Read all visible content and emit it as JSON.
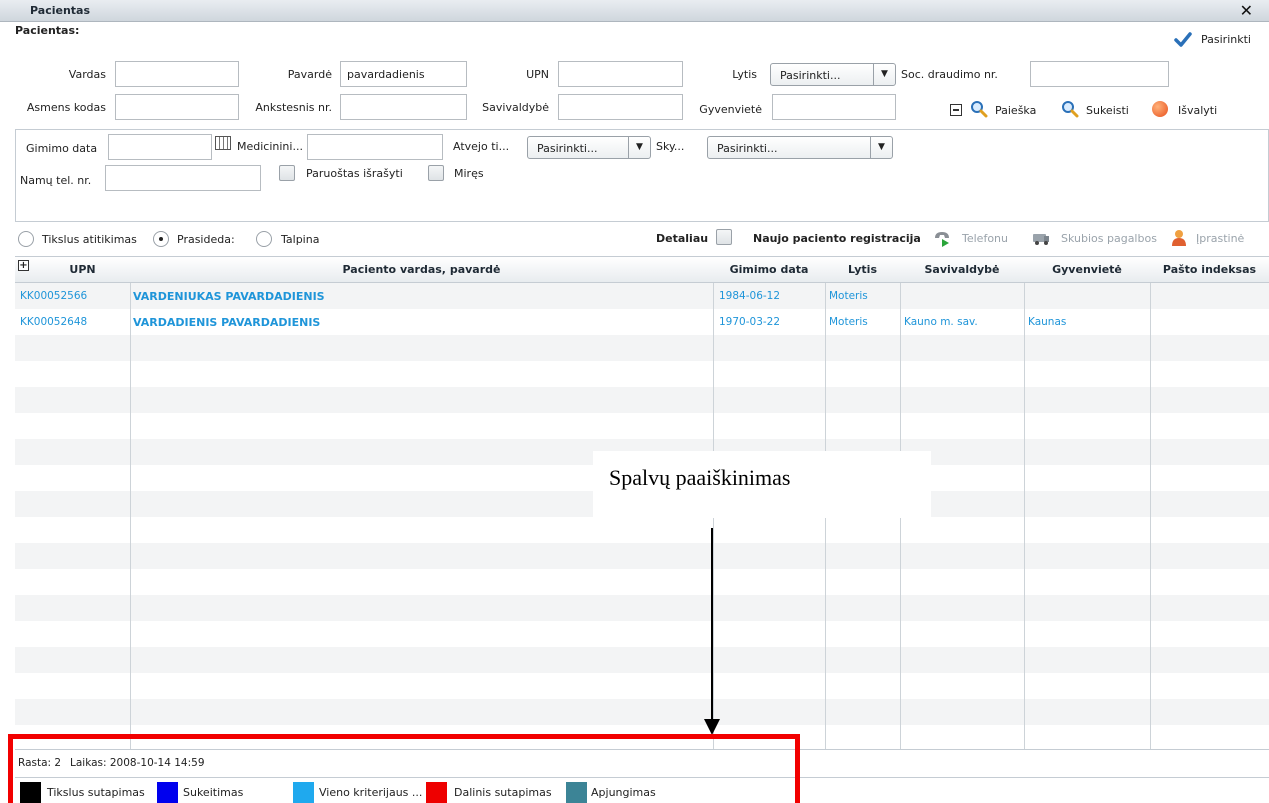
{
  "window": {
    "title": "Pacientas",
    "close_symbol": "✕"
  },
  "section_title": "Pacientas:",
  "select_button": "Pasirinkti",
  "fields": {
    "vardas": {
      "label": "Vardas",
      "value": ""
    },
    "pavarde": {
      "label": "Pavardė",
      "value": "pavardadienis"
    },
    "upn": {
      "label": "UPN",
      "value": ""
    },
    "lytis": {
      "label": "Lytis",
      "value": "Pasirinkti..."
    },
    "soc": {
      "label": "Soc. draudimo nr.",
      "value": ""
    },
    "asmens_kodas": {
      "label": "Asmens kodas",
      "value": ""
    },
    "ankstesnis": {
      "label": "Ankstesnis nr.",
      "value": ""
    },
    "savivaldybe": {
      "label": "Savivaldybė",
      "value": ""
    },
    "gyvenviete": {
      "label": "Gyvenvietė",
      "value": ""
    }
  },
  "actions": {
    "search": "Paieška",
    "swap": "Sukeisti",
    "clear": "Išvalyti"
  },
  "extra": {
    "gimimo_data": "Gimimo data",
    "medicinini": "Medicinini...",
    "atvejo": "Atvejo ti...",
    "atvejo_value": "Pasirinkti...",
    "sky": "Sky...",
    "sky_value": "Pasirinkti...",
    "namu_tel": "Namų tel. nr.",
    "paruostas": "Paruoštas išrašyti",
    "mires": "Miręs"
  },
  "match_modes": {
    "exact": "Tikslus atitikimas",
    "starts": "Prasideda:",
    "contains": "Talpina",
    "selected": "starts"
  },
  "toolbar": {
    "detaliau": "Detaliau",
    "new_reg": "Naujo paciento registracija",
    "telefonu": "Telefonu",
    "skubios": "Skubios pagalbos",
    "iprastine": "Įprastinė"
  },
  "table": {
    "expand_symbol": "+",
    "columns": [
      "UPN",
      "Paciento vardas, pavardė",
      "Gimimo data",
      "Lytis",
      "Savivaldybė",
      "Gyvenvietė",
      "Pašto indeksas"
    ],
    "rows": [
      {
        "upn": "KK00052566",
        "name": "VARDENIUKAS PAVARDADIENIS",
        "birth": "1984-06-12",
        "sex": "Moteris",
        "savivaldybe": "",
        "gyvenviete": "",
        "postal": ""
      },
      {
        "upn": "KK00052648",
        "name": "VARDADIENIS PAVARDADIENIS",
        "birth": "1970-03-22",
        "sex": "Moteris",
        "savivaldybe": "Kauno m. sav.",
        "gyvenviete": "Kaunas",
        "postal": ""
      }
    ]
  },
  "annotation": "Spalvų paaiškinimas",
  "status": {
    "rasta": "Rasta: 2",
    "laikas": "Laikas: 2008-10-14 14:59"
  },
  "legend": [
    {
      "label": "Tikslus sutapimas",
      "color": "#000000"
    },
    {
      "label": "Sukeitimas",
      "color": "#0000ee"
    },
    {
      "label": "Vieno kriterijaus ...",
      "color": "#1fa9ee"
    },
    {
      "label": "Dalinis sutapimas",
      "color": "#ee0000"
    },
    {
      "label": "Apjungimas",
      "color": "#3c8496"
    }
  ],
  "colors": {
    "link": "#1f95d9",
    "highlight_box": "#f20000",
    "title_bar": "#d8dee4"
  }
}
